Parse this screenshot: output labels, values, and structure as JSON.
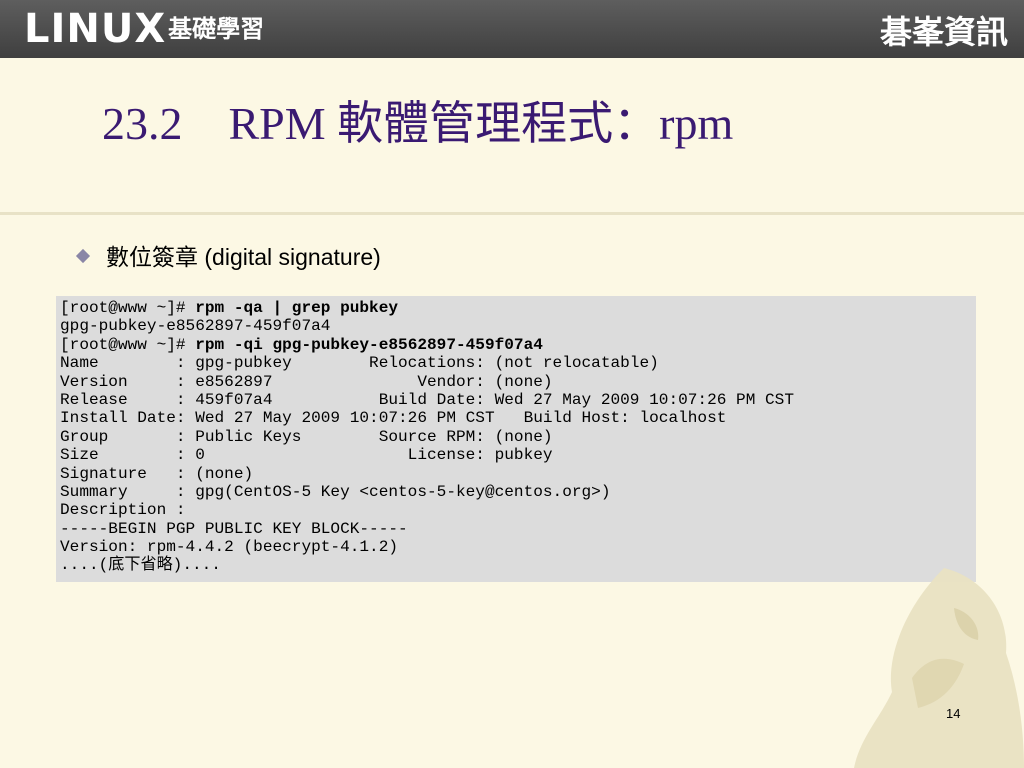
{
  "header": {
    "brand_latin": "LINUX",
    "brand_cjk": "基礎學習",
    "publisher": "碁峯資訊"
  },
  "slide": {
    "title": "23.2　RPM 軟體管理程式：rpm",
    "bullet": "數位簽章 (digital signature)",
    "page_number": "14"
  },
  "terminal": {
    "lines": [
      {
        "prompt": "[root@www ~]# ",
        "command": "rpm -qa | grep pubkey"
      },
      {
        "text": "gpg-pubkey-e8562897-459f07a4"
      },
      {
        "prompt": "[root@www ~]# ",
        "command": "rpm -qi gpg-pubkey-e8562897-459f07a4"
      },
      {
        "text": "Name        : gpg-pubkey        Relocations: (not relocatable)"
      },
      {
        "text": "Version     : e8562897               Vendor: (none)"
      },
      {
        "text": "Release     : 459f07a4           Build Date: Wed 27 May 2009 10:07:26 PM CST"
      },
      {
        "text": "Install Date: Wed 27 May 2009 10:07:26 PM CST   Build Host: localhost"
      },
      {
        "text": "Group       : Public Keys        Source RPM: (none)"
      },
      {
        "text": "Size        : 0                     License: pubkey"
      },
      {
        "text": "Signature   : (none)"
      },
      {
        "text": "Summary     : gpg(CentOS-5 Key <centos-5-key@centos.org>)"
      },
      {
        "text": "Description :"
      },
      {
        "text": "-----BEGIN PGP PUBLIC KEY BLOCK-----"
      },
      {
        "text": "Version: rpm-4.4.2 (beecrypt-4.1.2)"
      },
      {
        "text": "....(底下省略)...."
      }
    ]
  }
}
